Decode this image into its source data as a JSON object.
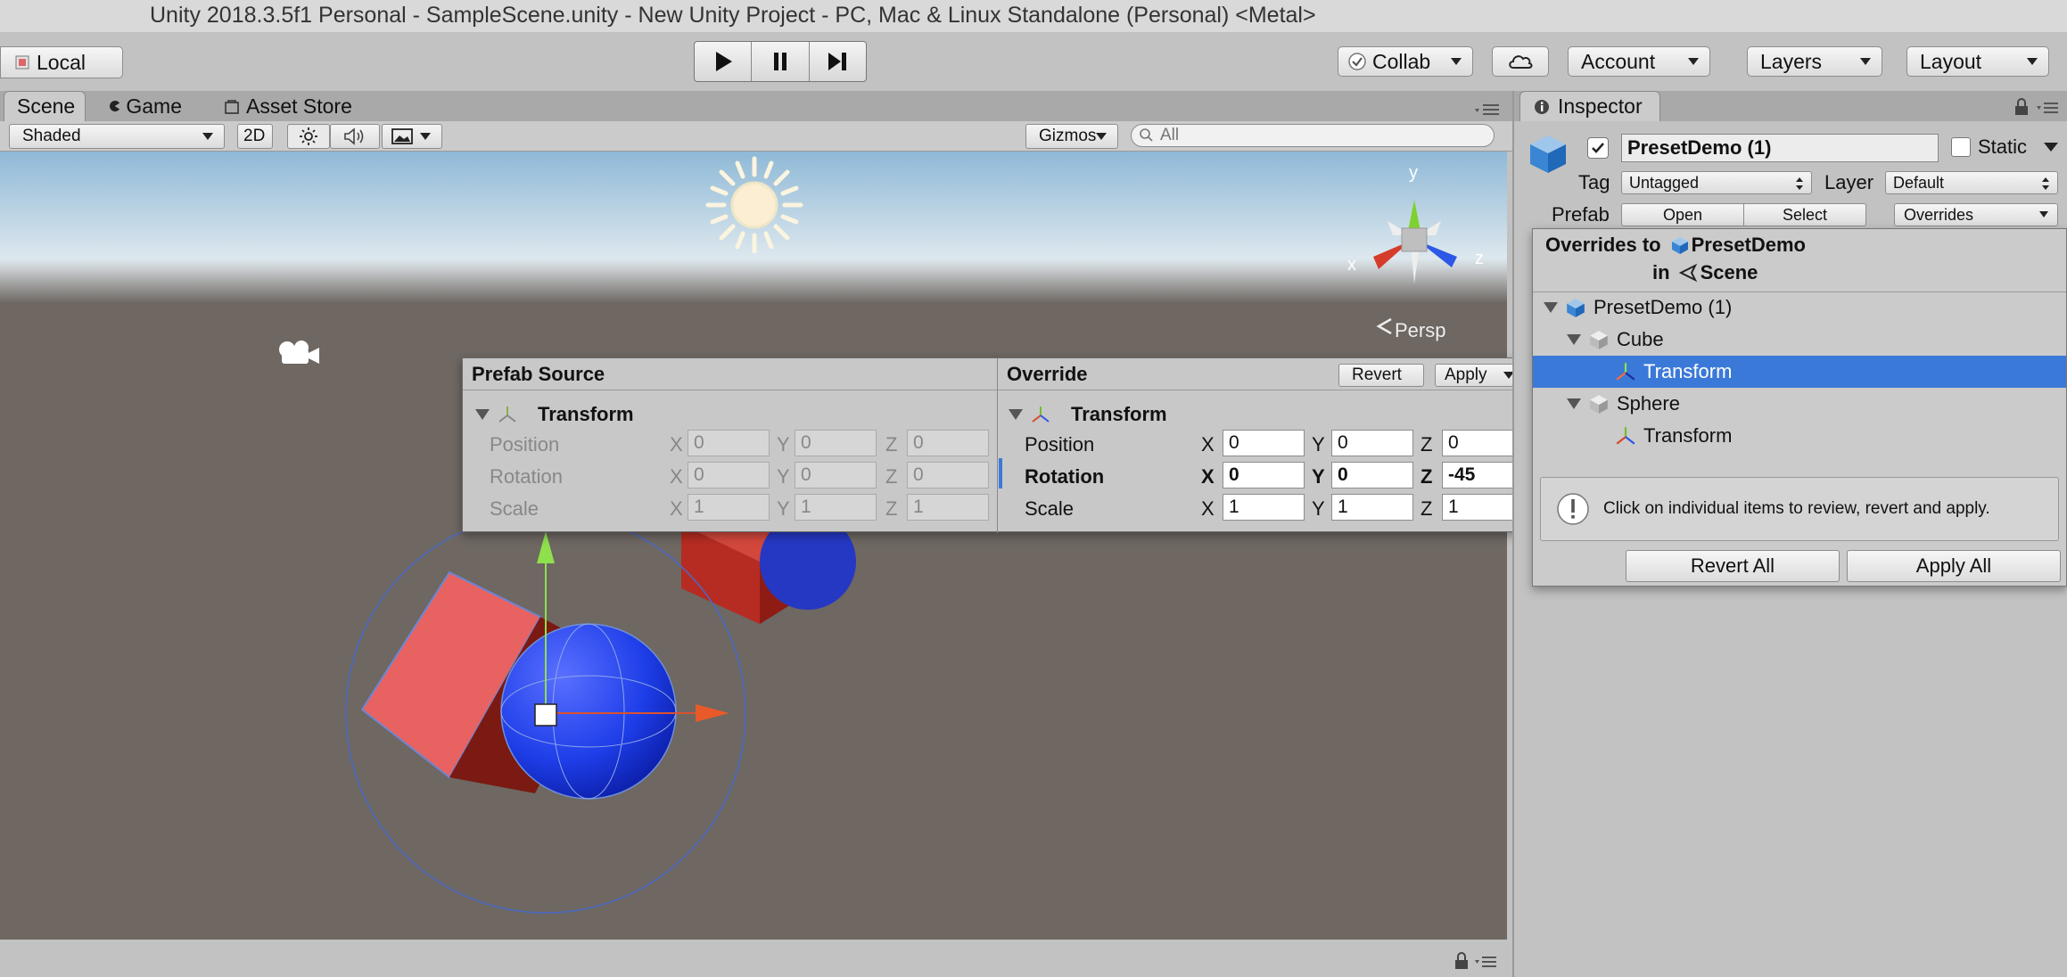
{
  "window": {
    "title": "Unity 2018.3.5f1 Personal - SampleScene.unity - New Unity Project - PC, Mac & Linux Standalone (Personal) <Metal>"
  },
  "toolbar": {
    "pivot_label": "Local",
    "collab_label": "Collab",
    "account_label": "Account",
    "layers_label": "Layers",
    "layout_label": "Layout"
  },
  "tabs": [
    {
      "label": "Scene",
      "active": true
    },
    {
      "label": "Game",
      "active": false
    },
    {
      "label": "Asset Store",
      "active": false
    }
  ],
  "scene_toolbar": {
    "shading_mode": "Shaded",
    "mode_2d": "2D",
    "gizmos_label": "Gizmos",
    "search_placeholder": "All"
  },
  "scene": {
    "gizmo_axes": {
      "y": "y",
      "x": "x",
      "z": "z"
    },
    "projection_label": "Persp"
  },
  "override_panel": {
    "source_header": "Prefab Source",
    "override_header": "Override",
    "revert_label": "Revert",
    "apply_label": "Apply",
    "component": "Transform",
    "source": {
      "rows": [
        {
          "label": "Position",
          "x": "0",
          "y": "0",
          "z": "0"
        },
        {
          "label": "Rotation",
          "x": "0",
          "y": "0",
          "z": "0"
        },
        {
          "label": "Scale",
          "x": "1",
          "y": "1",
          "z": "1"
        }
      ]
    },
    "override": {
      "rows": [
        {
          "label": "Position",
          "x": "0",
          "y": "0",
          "z": "0",
          "modified": false
        },
        {
          "label": "Rotation",
          "x": "0",
          "y": "0",
          "z": "-45",
          "modified": true
        },
        {
          "label": "Scale",
          "x": "1",
          "y": "1",
          "z": "1",
          "modified": false
        }
      ]
    },
    "axis_labels": {
      "x": "X",
      "y": "Y",
      "z": "Z"
    }
  },
  "inspector": {
    "tab_label": "Inspector",
    "object_name": "PresetDemo (1)",
    "static_label": "Static",
    "tag_label": "Tag",
    "tag_value": "Untagged",
    "layer_label": "Layer",
    "layer_value": "Default",
    "prefab_label": "Prefab",
    "open_label": "Open",
    "select_label": "Select",
    "overrides_label": "Overrides"
  },
  "overrides_popup": {
    "title_prefix": "Overrides to",
    "prefab_name": "PresetDemo",
    "in_label": "in",
    "scene_name": "Scene",
    "tree": [
      {
        "label": "PresetDemo (1)"
      },
      {
        "label": "Cube"
      },
      {
        "label": "Transform",
        "selected": true
      },
      {
        "label": "Sphere"
      },
      {
        "label": "Transform",
        "selected": false
      }
    ],
    "info_text": "Click on individual items to review, revert and apply.",
    "revert_all_label": "Revert All",
    "apply_all_label": "Apply All"
  },
  "colors": {
    "selection": "#3b79d8",
    "sky_top": "#8fb9d7",
    "ground": "#6e6762",
    "cube_red": "#e86262",
    "sphere_blue": "#1e3ee8"
  }
}
